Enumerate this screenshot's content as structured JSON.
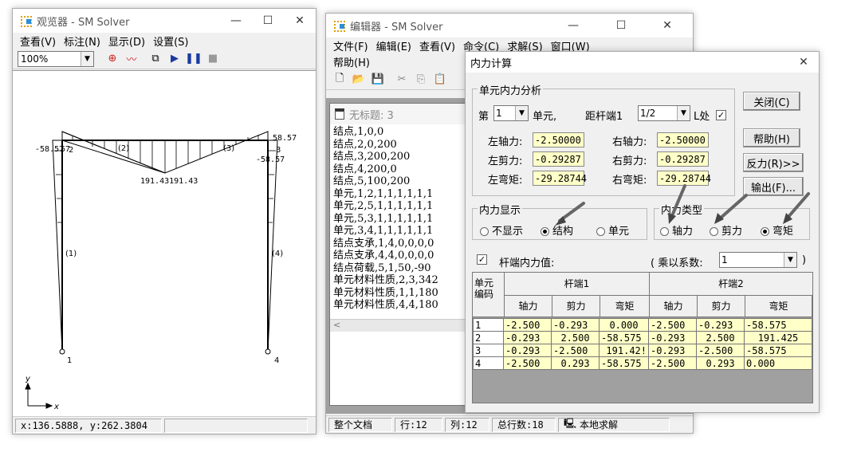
{
  "viewer": {
    "title": "观览器 - SM Solver",
    "menu": [
      "查看(V)",
      "标注(N)",
      "显示(D)",
      "设置(S)"
    ],
    "zoom": "100%",
    "labels": {
      "m_left_top": "-58.57",
      "m_left_top2": "57",
      "m_right_top": "58.57",
      "m_right_mid": "-58.57",
      "m_center": "191.43191.43",
      "elem2": "(2)",
      "elem3": "(3)",
      "elem1": "(1)",
      "elem4": "(4)",
      "node2": "2",
      "node3": "3",
      "node1": "1",
      "node4": "4",
      "axis_y": "y",
      "axis_x": "x"
    },
    "status": "x:136.5888, y:262.3804"
  },
  "editor": {
    "title": "编辑器 - SM Solver",
    "menu": [
      "文件(F)",
      "编辑(E)",
      "查看(V)",
      "命令(C)",
      "求解(S)",
      "窗口(W)"
    ],
    "menu2": "帮助(H)",
    "doc_title": "无标题: 3",
    "lines": [
      "结点,1,0,0",
      "结点,2,0,200",
      "结点,3,200,200",
      "结点,4,200,0",
      "结点,5,100,200",
      "单元,1,2,1,1,1,1,1,1",
      "单元,2,5,1,1,1,1,1,1",
      "单元,5,3,1,1,1,1,1,1",
      "单元,3,4,1,1,1,1,1,1",
      "结点支承,1,4,0,0,0,0",
      "结点支承,4,4,0,0,0,0",
      "结点荷载,5,1,50,-90",
      "单元材料性质,2,3,342",
      "单元材料性质,1,1,180",
      "单元材料性质,4,4,180"
    ],
    "status": {
      "doc": "整个文档",
      "row": "行:12",
      "col": "列:12",
      "total": "总行数:18",
      "mode": "本地求解"
    }
  },
  "dialog": {
    "title": "内力计算",
    "group_elem": "单元内力分析",
    "label_di": "第",
    "elem_no": "1",
    "label_unit": "单元,",
    "label_dist": "距杆端1",
    "dist": "1/2",
    "label_L": "L处",
    "left_axial_lbl": "左轴力:",
    "left_axial": "-2.50000",
    "right_axial_lbl": "右轴力:",
    "right_axial": "-2.50000",
    "left_shear_lbl": "左剪力:",
    "left_shear": "-0.29287",
    "right_shear_lbl": "右剪力:",
    "right_shear": "-0.29287",
    "left_moment_lbl": "左弯矩:",
    "left_moment": "-29.28744",
    "right_moment_lbl": "右弯矩:",
    "right_moment": "-29.28744",
    "btn_close": "关闭(C)",
    "btn_help": "帮助(H)",
    "btn_reaction": "反力(R)>>",
    "btn_output": "输出(F)...",
    "group_display": "内力显示",
    "opt_none": "不显示",
    "opt_struct": "结构",
    "opt_elem": "单元",
    "group_type": "内力类型",
    "opt_axial": "轴力",
    "opt_shear": "剪力",
    "opt_moment": "弯矩",
    "chk_end": "杆端内力值:",
    "factor_lbl": "( 乘以系数:",
    "factor": "1",
    "factor_close": ")",
    "table": {
      "h_elem": "单元编码",
      "h_end1": "杆端1",
      "h_end2": "杆端2",
      "cols": [
        "轴力",
        "剪力",
        "弯矩",
        "轴力",
        "剪力",
        "弯矩"
      ],
      "rows": [
        [
          "1",
          "-2.500",
          "-0.293",
          "0.000",
          "-2.500",
          "-0.293",
          "-58.575"
        ],
        [
          "2",
          "-0.293",
          "2.500",
          "-58.575",
          "-0.293",
          "2.500",
          "191.425"
        ],
        [
          "3",
          "-0.293",
          "-2.500",
          "191.42!",
          "-0.293",
          "-2.500",
          "-58.575"
        ],
        [
          "4",
          "-2.500",
          "0.293",
          "-58.575",
          "-2.500",
          "0.293",
          "0.000"
        ]
      ]
    }
  }
}
